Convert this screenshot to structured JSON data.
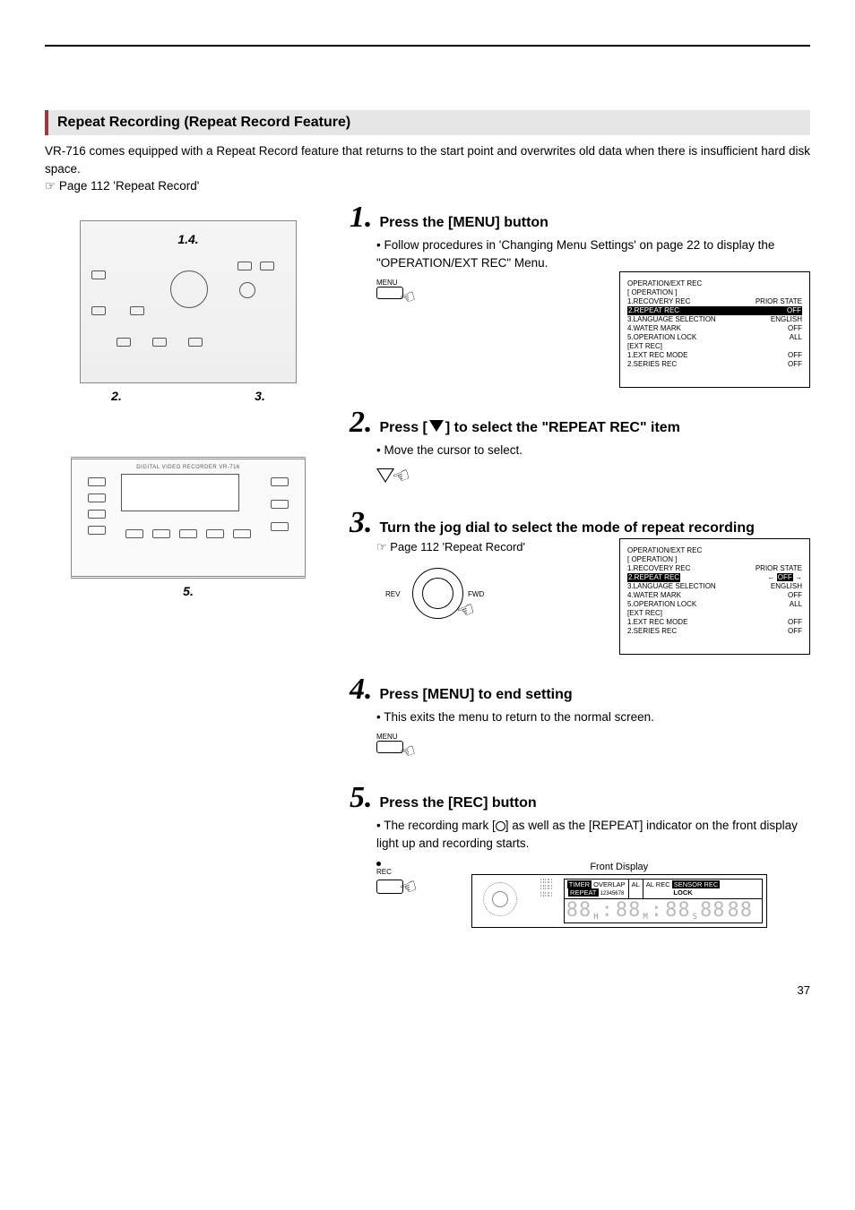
{
  "section_title": "Repeat Recording (Repeat Record Feature)",
  "intro": "VR-716 comes equipped with a Repeat Record feature that returns to the start point and overwrites old data when there is insufficient hard disk space.",
  "intro_ref": "☞ Page 112 'Repeat Record'",
  "device_callouts": {
    "top": "1.4.",
    "bottom_left": "2.",
    "bottom_right": "3."
  },
  "panel_callout": "5.",
  "panel_label": "DIGITAL VIDEO RECORDER VR-716",
  "steps": {
    "s1": {
      "num": "1.",
      "title": "Press the [MENU] button",
      "body": "Follow procedures in 'Changing Menu Settings' on page 22 to display the \"OPERATION/EXT REC\" Menu.",
      "btn": "MENU"
    },
    "s2": {
      "num": "2.",
      "title_pre": "Press [",
      "title_post": "] to select the \"REPEAT REC\" item",
      "body": "Move the cursor to select."
    },
    "s3": {
      "num": "3.",
      "title": "Turn the jog dial to select the mode of repeat recording",
      "ref": "☞ Page 112 'Repeat Record'",
      "rev": "REV",
      "fwd": "FWD"
    },
    "s4": {
      "num": "4.",
      "title": "Press [MENU] to end setting",
      "body": "This exits the menu to return to the normal screen.",
      "btn": "MENU"
    },
    "s5": {
      "num": "5.",
      "title": "Press the [REC] button",
      "body_pre": "The recording mark [",
      "body_post": "] as well as the [REPEAT] indicator on the front display light up and recording starts.",
      "btn": "REC",
      "fd_label": "Front Display"
    }
  },
  "osd1": {
    "header": "OPERATION/EXT REC",
    "sub1": "[ OPERATION ]",
    "rows": [
      {
        "l": "1.RECOVERY REC",
        "r": "PRIOR STATE"
      },
      {
        "l": "2.REPEAT REC",
        "r": "OFF",
        "hl": true
      },
      {
        "l": "3.LANGUAGE SELECTION",
        "r": "ENGLISH"
      },
      {
        "l": "4.WATER MARK",
        "r": "OFF"
      },
      {
        "l": "5.OPERATION LOCK",
        "r": "ALL"
      }
    ],
    "sub2": "[EXT REC]",
    "rows2": [
      {
        "l": "1.EXT REC MODE",
        "r": "OFF"
      },
      {
        "l": "2.SERIES REC",
        "r": "OFF"
      }
    ]
  },
  "osd2": {
    "header": "OPERATION/EXT REC",
    "sub1": "[ OPERATION ]",
    "rows": [
      {
        "l": "1.RECOVERY REC",
        "r": "PRIOR STATE"
      },
      {
        "l": "2.REPEAT REC",
        "r": "OFF",
        "hl": true,
        "arrows": true
      },
      {
        "l": "3.LANGUAGE SELECTION",
        "r": "ENGLISH"
      },
      {
        "l": "4.WATER MARK",
        "r": "OFF"
      },
      {
        "l": "5.OPERATION LOCK",
        "r": "ALL"
      }
    ],
    "sub2": "[EXT REC]",
    "rows2": [
      {
        "l": "1.EXT REC MODE",
        "r": "OFF"
      },
      {
        "l": "2.SERIES REC",
        "r": "OFF"
      }
    ]
  },
  "front_display": {
    "timer": "TIMER",
    "overlap": "OVERLAP",
    "repeat": "REPEAT",
    "counter": "12345678",
    "al": "AL",
    "alrec": "AL REC",
    "sensor": "SENSOR REC",
    "lock": "LOCK",
    "seg": "88 88 88 88 88",
    "h": "H",
    "m": "M",
    "s": "S"
  },
  "page_number": "37"
}
